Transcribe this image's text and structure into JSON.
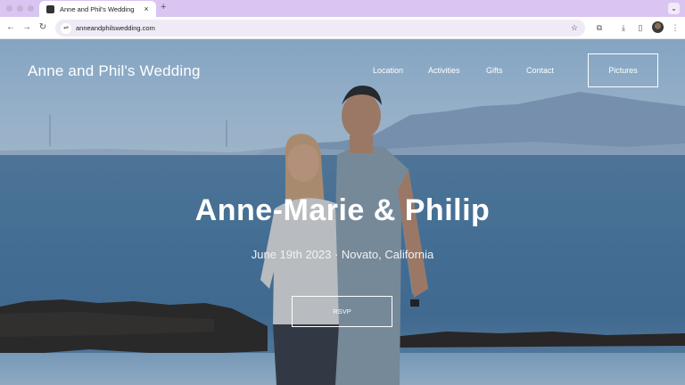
{
  "browser": {
    "tab_title": "Anne and Phil's Wedding",
    "new_tab": "+",
    "close": "×",
    "tab_menu": "⌄",
    "url": "anneandphilswedding.com",
    "icons": {
      "back": "←",
      "forward": "→",
      "reload": "↻",
      "site_info": "⇌",
      "star": "☆",
      "extensions": "⧉",
      "download": "⤓",
      "sidebar": "▯",
      "menu": "⋮"
    }
  },
  "site": {
    "brand": "Anne and Phil's Wedding",
    "nav": [
      "Location",
      "Activities",
      "Gifts",
      "Contact"
    ],
    "cta": "Pictures"
  },
  "hero": {
    "title": "Anne-Marie & Philip",
    "subtitle": "June 19th 2023 · Novato, California",
    "button": "RSVP"
  },
  "colors": {
    "tab_strip": "#d9c4f2",
    "omnibox": "#efeaf5",
    "sea": "#4f7ea8",
    "sky": "#a9c8e4"
  }
}
